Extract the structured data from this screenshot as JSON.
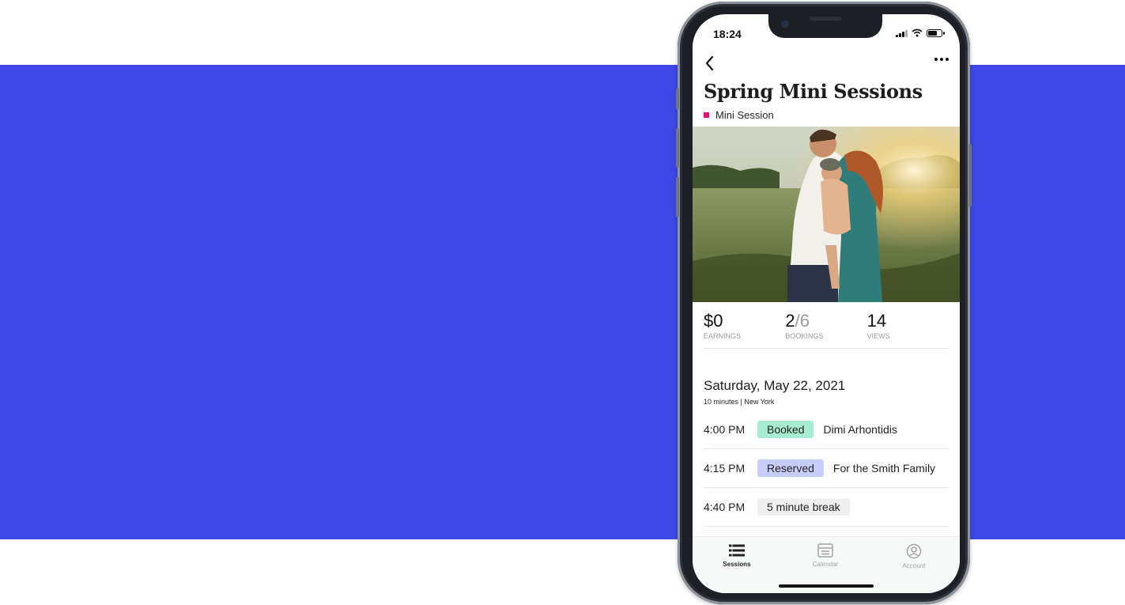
{
  "colors": {
    "band": "#3e47e6",
    "tag_dot": "#e0147a",
    "booked_bg": "#a6ecd1",
    "reserved_bg": "#c7cdfb",
    "break_bg": "#efefef",
    "tab_active": "#222222",
    "tab_inactive": "#a3a3a3"
  },
  "status_bar": {
    "time": "18:24",
    "icons": [
      "signal-icon",
      "wifi-icon",
      "battery-icon"
    ]
  },
  "nav": {
    "back_icon": "chevron-left-icon",
    "menu_icon": "more-dots-icon"
  },
  "session": {
    "title": "Spring Mini Sessions",
    "type_label": "Mini Session"
  },
  "photo": {
    "subject": "family photo"
  },
  "stats": {
    "earnings": {
      "value": "$0",
      "label": "EARNINGS"
    },
    "bookings": {
      "booked": "2",
      "total": "/6",
      "label": "BOOKINGS"
    },
    "views": {
      "value": "14",
      "label": "VIEWS"
    }
  },
  "schedule": {
    "date": "Saturday, May 22, 2021",
    "meta": "10 minutes | New York",
    "slots": [
      {
        "time": "4:00 PM",
        "status": "Booked",
        "name": "Dimi Arhontidis"
      },
      {
        "time": "4:15 PM",
        "status": "Reserved",
        "name": "For the Smith Family"
      },
      {
        "time": "4:40 PM",
        "status": "5 minute break",
        "name": ""
      }
    ]
  },
  "tabs": [
    {
      "label": "Sessions",
      "icon": "list-icon",
      "active": true
    },
    {
      "label": "Calendar",
      "icon": "calendar-icon",
      "active": false
    },
    {
      "label": "Account",
      "icon": "account-icon",
      "active": false
    }
  ]
}
